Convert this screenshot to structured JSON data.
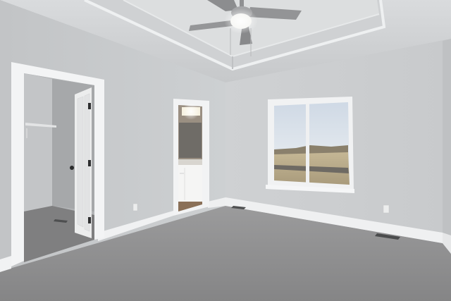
{
  "scene": {
    "subject": "empty-bedroom",
    "colors": {
      "wall": "#c9cbcd",
      "wall_shadow": "#b9bbbd",
      "ceiling": "#d5d7d9",
      "trim": "#f2f3f4",
      "carpet": "#8f8f90",
      "sky": "#dfe6ee",
      "field": "#b3a68a",
      "closet_dark": "#a9abad",
      "fan_blade": "#8e8f91",
      "fan_light": "#f4f4f0"
    },
    "objects": [
      "tray-ceiling",
      "ceiling-fan",
      "walk-in-closet-door",
      "bathroom-doorway",
      "window",
      "baseboards",
      "carpet-floor",
      "floor-vents",
      "wall-outlets"
    ]
  }
}
